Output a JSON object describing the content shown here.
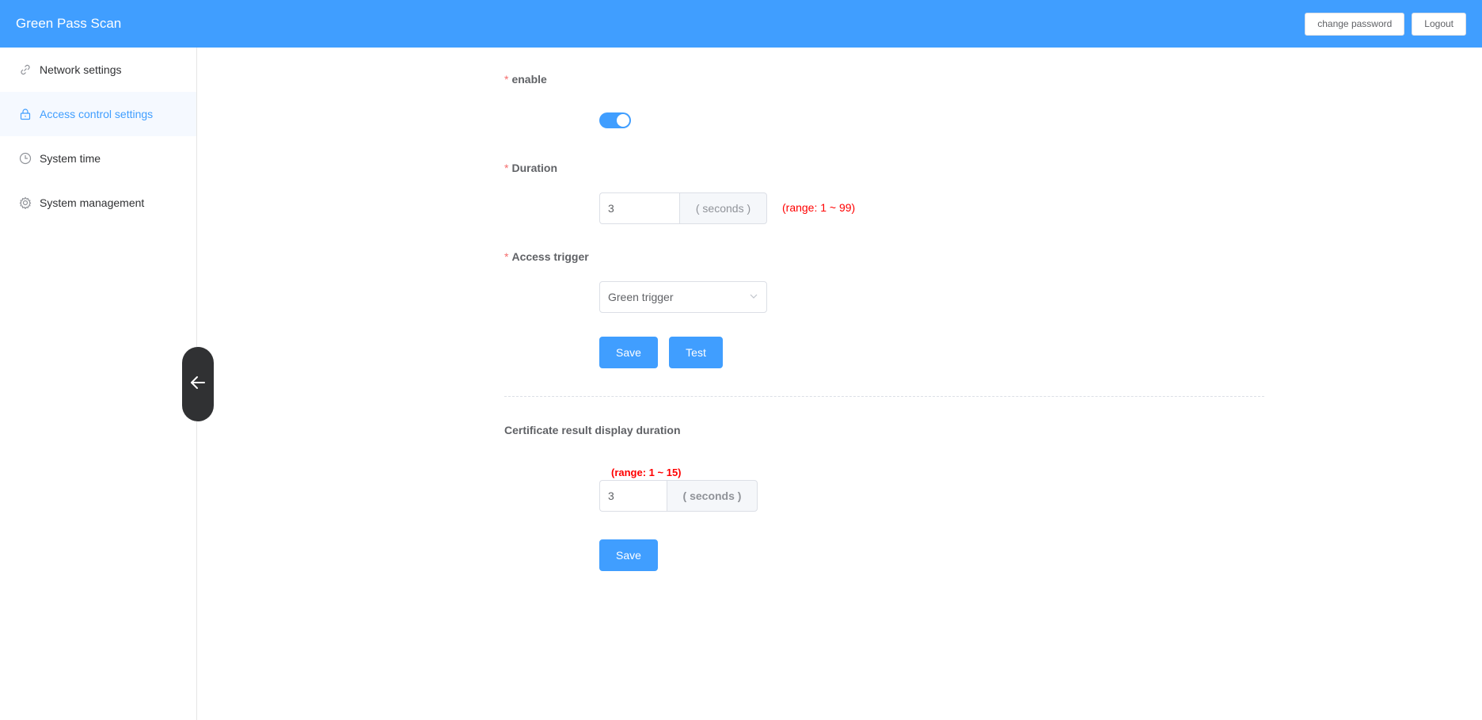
{
  "app": {
    "title": "Green Pass Scan"
  },
  "header": {
    "change_password": "change password",
    "logout": "Logout"
  },
  "sidebar": {
    "items": [
      {
        "label": "Network settings",
        "icon": "link-icon",
        "active": false
      },
      {
        "label": "Access control settings",
        "icon": "lock-icon",
        "active": true
      },
      {
        "label": "System time",
        "icon": "clock-icon",
        "active": false
      },
      {
        "label": "System management",
        "icon": "gear-icon",
        "active": false
      }
    ]
  },
  "form": {
    "enable_label": "enable",
    "enable_value": true,
    "duration_label": "Duration",
    "duration_value": "3",
    "duration_unit": "( seconds )",
    "duration_range": "(range:  1 ~ 99)",
    "trigger_label": "Access trigger",
    "trigger_value": "Green trigger",
    "save_label": "Save",
    "test_label": "Test",
    "required_mark": "*"
  },
  "cert": {
    "label": "Certificate result display duration",
    "range": "(range:  1 ~ 15)",
    "value": "3",
    "unit": "( seconds )",
    "save_label": "Save"
  },
  "colors": {
    "primary": "#409eff",
    "danger": "#ff0000",
    "dark": "#303133"
  }
}
